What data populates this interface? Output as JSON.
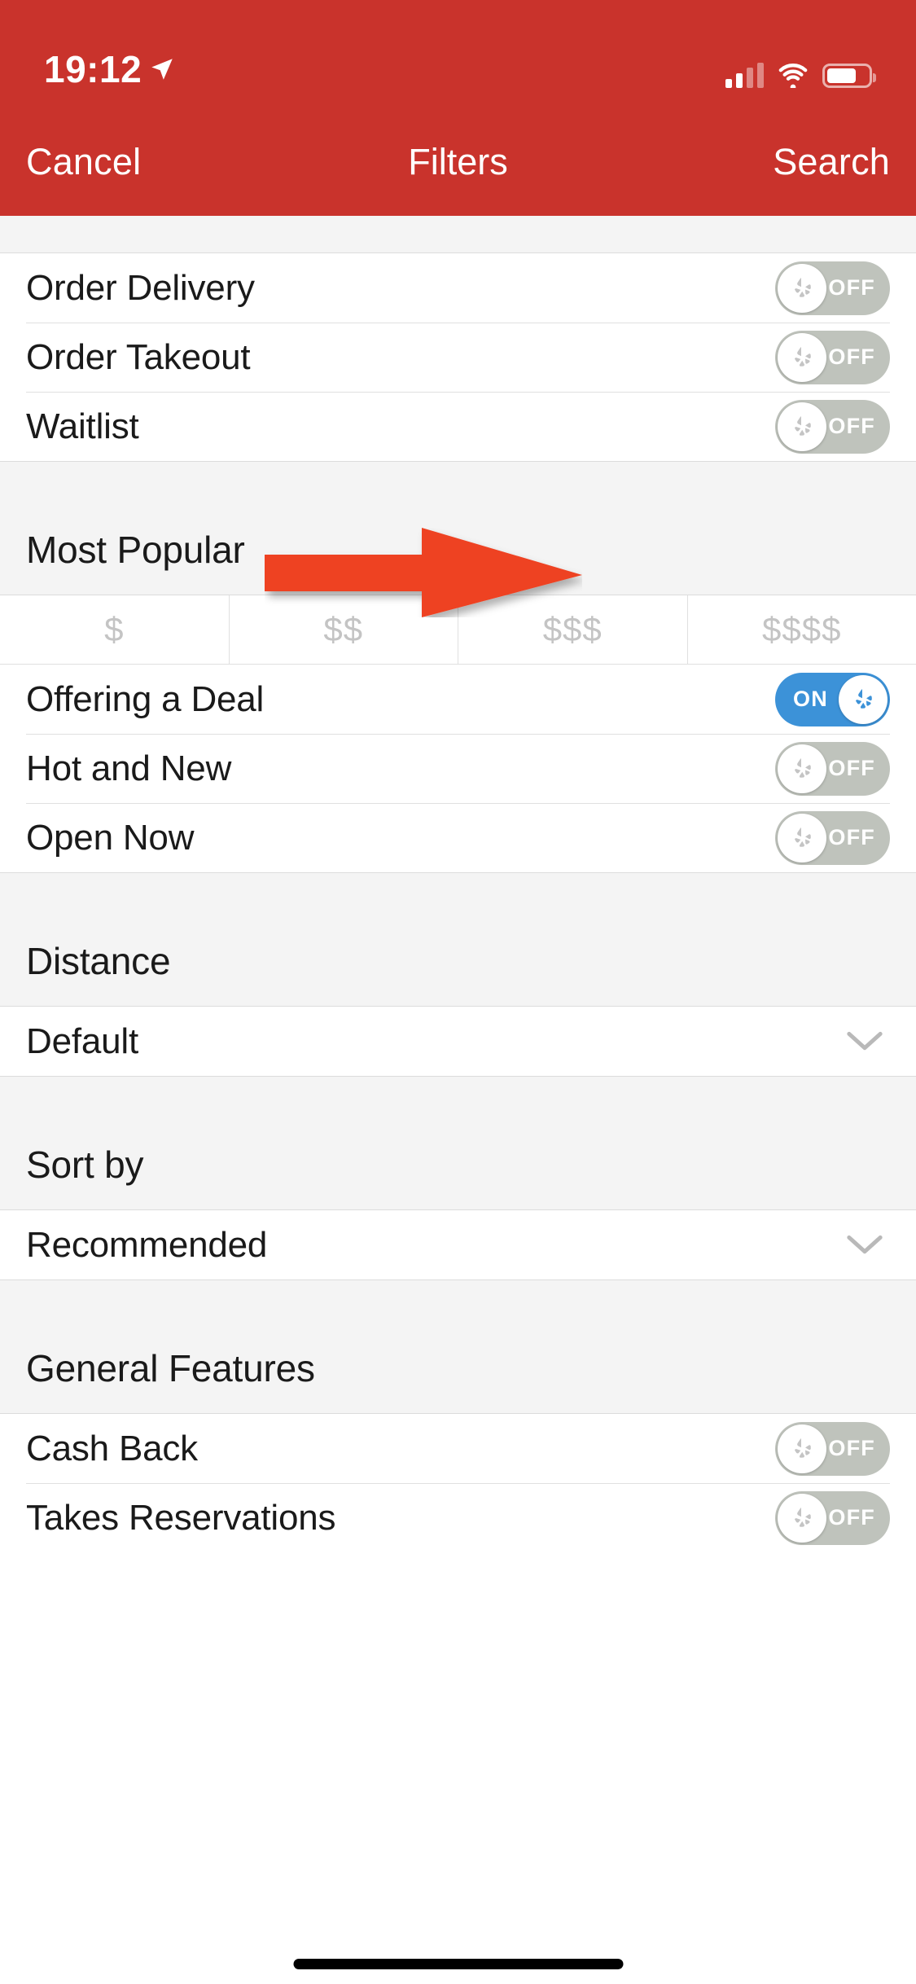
{
  "status_bar": {
    "time": "19:12",
    "location_icon": "location-arrow-icon",
    "cellular_icon": "cellular-signal-icon",
    "wifi_icon": "wifi-icon",
    "battery_icon": "battery-icon"
  },
  "nav": {
    "cancel_label": "Cancel",
    "title": "Filters",
    "search_label": "Search"
  },
  "colors": {
    "brand_red": "#C9332C",
    "toggle_on_blue": "#3C92D8",
    "toggle_off_gray": "#BFC3BC",
    "annotation_red": "#EE4223",
    "section_bg": "#F4F4F4"
  },
  "sections": [
    {
      "header": null,
      "rows": [
        {
          "label": "Order Delivery",
          "state": "OFF",
          "on": false
        },
        {
          "label": "Order Takeout",
          "state": "OFF",
          "on": false
        },
        {
          "label": "Waitlist",
          "state": "OFF",
          "on": false
        }
      ]
    },
    {
      "header": "Most Popular",
      "price_options": [
        "$",
        "$$",
        "$$$",
        "$$$$"
      ],
      "rows": [
        {
          "label": "Offering a Deal",
          "state": "ON",
          "on": true
        },
        {
          "label": "Hot and New",
          "state": "OFF",
          "on": false
        },
        {
          "label": "Open Now",
          "state": "OFF",
          "on": false
        }
      ]
    },
    {
      "header": "Distance",
      "disclosure": {
        "label": "Default",
        "icon": "chevron-down-icon"
      }
    },
    {
      "header": "Sort by",
      "disclosure": {
        "label": "Recommended",
        "icon": "chevron-down-icon"
      }
    },
    {
      "header": "General Features",
      "rows": [
        {
          "label": "Cash Back",
          "state": "OFF",
          "on": false
        },
        {
          "label": "Takes Reservations",
          "state": "OFF",
          "on": false
        }
      ]
    }
  ],
  "annotation": {
    "type": "red-arrow-pointing-right",
    "target": "Offering a Deal toggle"
  }
}
